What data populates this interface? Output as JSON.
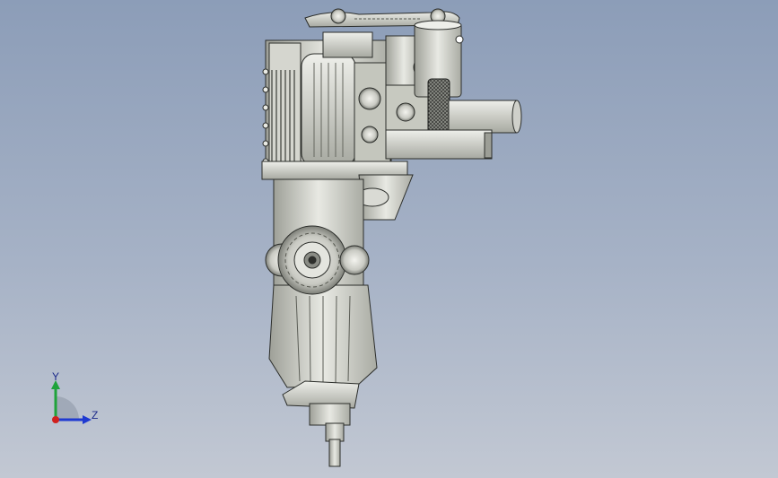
{
  "viewport": {
    "background_top": "#8c9db8",
    "background_bottom": "#c2c8d3"
  },
  "model": {
    "description_icon": "gearbox-engine-assembly-icon",
    "metal_light": "#e4e5df",
    "metal_mid": "#bfc1b8",
    "metal_dark": "#6f726b",
    "outline": "#2b2d2a"
  },
  "triad": {
    "y_label": "Y",
    "z_label": "Z",
    "y_color": "#1fa33a",
    "z_color": "#1f3ad1",
    "x_color": "#d0201e"
  }
}
